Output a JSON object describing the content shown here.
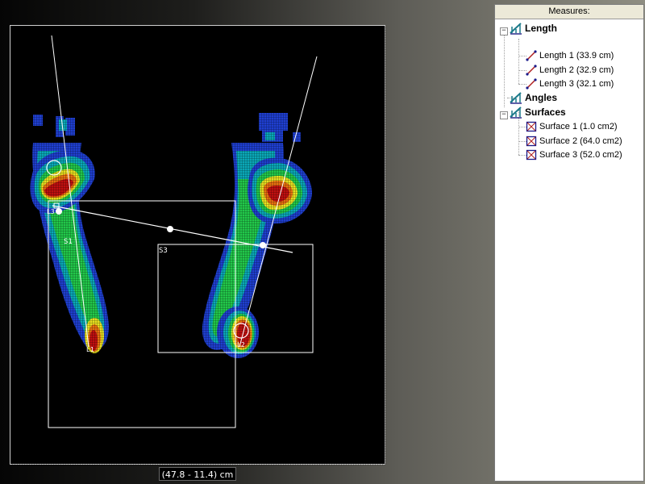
{
  "viewport": {
    "labels": {
      "surface1": "S1",
      "surface3": "S3",
      "length1": "L1",
      "length2": "L2",
      "length3": "L3"
    }
  },
  "coordinate_readout": "(47.8 - 11.4) cm",
  "measures_panel": {
    "title": "Measures:",
    "groups": [
      {
        "label": "Length",
        "expander": "−",
        "icon": "measure-tool-icon",
        "items": [
          {
            "label": "Length 1 (33.9 cm)",
            "icon": "line-segment-icon"
          },
          {
            "label": "Length 2 (32.9 cm)",
            "icon": "line-segment-icon"
          },
          {
            "label": "Length 3 (32.1 cm)",
            "icon": "line-segment-icon"
          }
        ]
      },
      {
        "label": "Angles",
        "expander": "",
        "icon": "measure-tool-icon",
        "items": []
      },
      {
        "label": "Surfaces",
        "expander": "−",
        "icon": "measure-tool-icon",
        "items": [
          {
            "label": "Surface 1 (1.0 cm2)",
            "icon": "surface-box-icon"
          },
          {
            "label": "Surface 2 (64.0 cm2)",
            "icon": "surface-box-icon"
          },
          {
            "label": "Surface 3 (52.0 cm2)",
            "icon": "surface-box-icon"
          }
        ]
      }
    ]
  },
  "colors": {
    "heat_low": "#1f3fd0",
    "heat_mid_low": "#0aa8b8",
    "heat_mid": "#22c84a",
    "heat_mid_high": "#e8e020",
    "heat_high": "#e87010",
    "heat_peak": "#c01010",
    "overlay": "#ffffff"
  }
}
